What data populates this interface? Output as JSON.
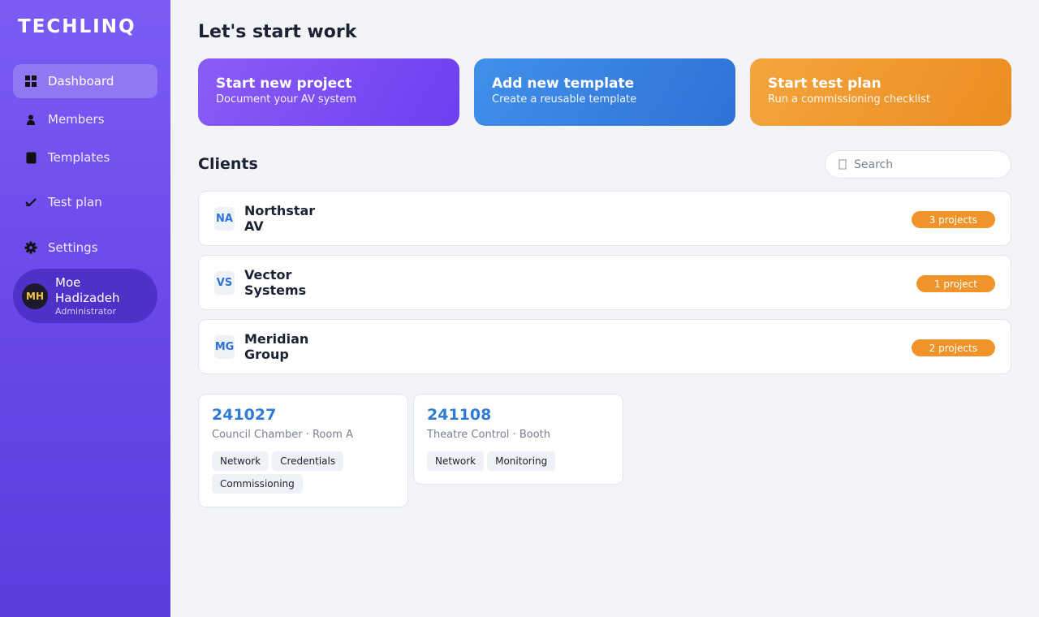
{
  "app": {
    "brand": "TECHLINQ"
  },
  "sidebar": {
    "items": [
      {
        "label": "Dashboard",
        "icon": "grid-icon",
        "active": true
      },
      {
        "label": "Members",
        "icon": "person-icon"
      },
      {
        "label": "Templates",
        "icon": "document-icon"
      },
      {
        "label": "Test plan",
        "icon": "checkmark-icon"
      },
      {
        "label": "Settings",
        "icon": "gear-icon"
      }
    ],
    "user": {
      "initials": "MH",
      "name": "Moe Hadizadeh",
      "role": "Administrator"
    }
  },
  "main": {
    "title": "Let's start work",
    "actions": [
      {
        "title": "Start new project",
        "subtitle": "Document your AV system",
        "color": "#7c4ff3"
      },
      {
        "title": "Add new template",
        "subtitle": "Create a reusable template",
        "color": "#3a82e2"
      },
      {
        "title": "Start test plan",
        "subtitle": "Run a commissioning checklist",
        "color": "#f09a2e"
      }
    ],
    "clients_title": "Clients",
    "search": {
      "placeholder": "Search"
    },
    "clients": [
      {
        "abbr": "NA",
        "name": "Northstar AV",
        "badge": "3 projects"
      },
      {
        "abbr": "VS",
        "name": "Vector Systems",
        "badge": "1 project"
      },
      {
        "abbr": "MG",
        "name": "Meridian Group",
        "badge": "2 projects"
      }
    ],
    "projects": [
      {
        "id": "241027",
        "location": "Council Chamber · Room A",
        "tags": [
          "Network",
          "Credentials",
          "Commissioning"
        ]
      },
      {
        "id": "241108",
        "location": "Theatre Control · Booth",
        "tags": [
          "Network",
          "Monitoring"
        ]
      }
    ]
  },
  "colors": {
    "accent": "#6a48ea",
    "link": "#2f7bd6",
    "badge": "#f0942a"
  }
}
